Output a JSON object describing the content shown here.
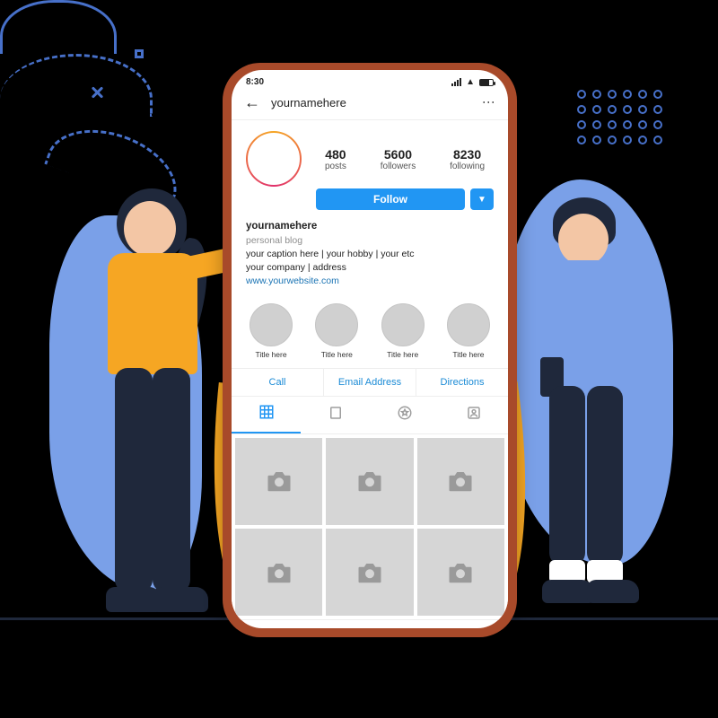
{
  "status": {
    "time": "8:30"
  },
  "header": {
    "username": "yournamehere"
  },
  "stats": {
    "posts": {
      "count": "480",
      "label": "posts"
    },
    "followers": {
      "count": "5600",
      "label": "followers"
    },
    "following": {
      "count": "8230",
      "label": "following"
    }
  },
  "actions": {
    "follow_label": "Follow"
  },
  "bio": {
    "display_name": "yournamehere",
    "category": "personal blog",
    "line1": "your caption here  | your hobby | your etc",
    "line2": "your company | address",
    "website": "www.yourwebsite.com"
  },
  "highlights": [
    {
      "title": "Title here"
    },
    {
      "title": "Title here"
    },
    {
      "title": "Title here"
    },
    {
      "title": "Title here"
    }
  ],
  "contact": {
    "call": "Call",
    "email": "Email Address",
    "directions": "Directions"
  }
}
